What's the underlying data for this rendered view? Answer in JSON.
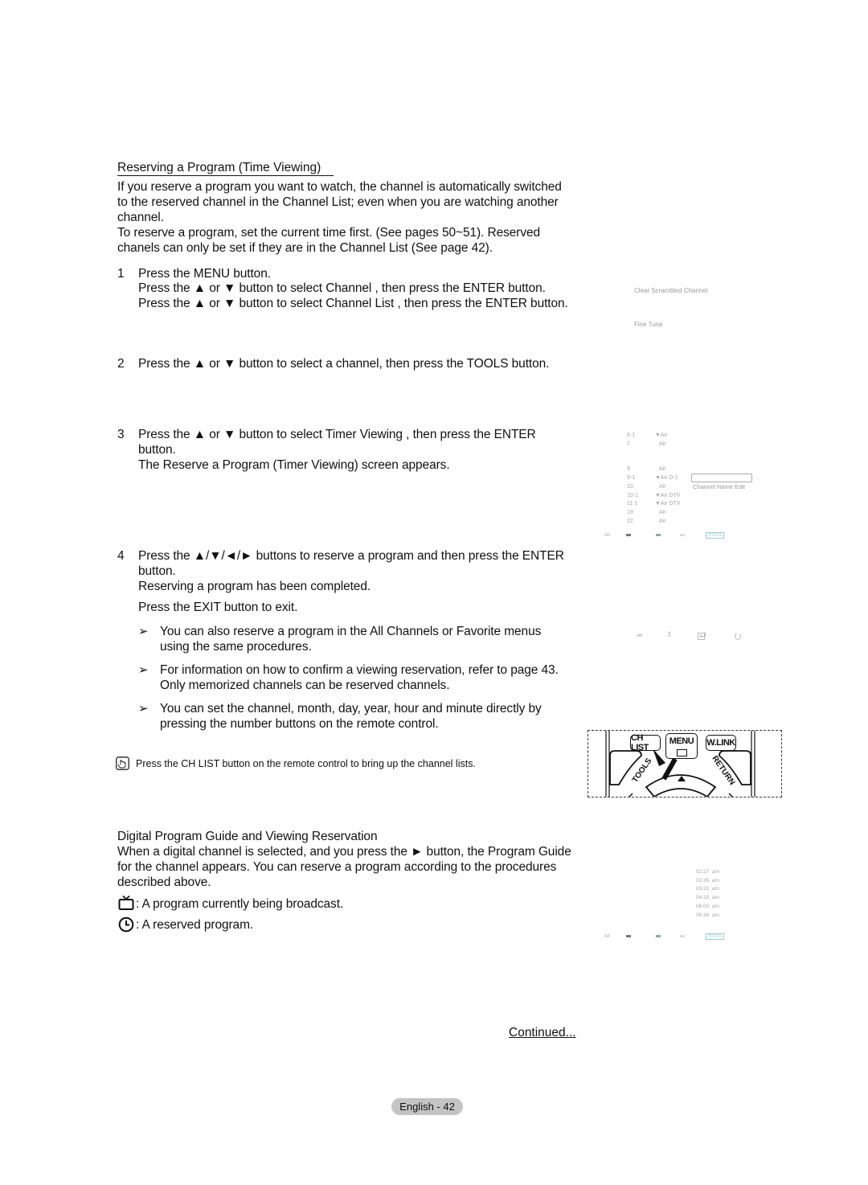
{
  "section1": {
    "title": "Reserving a Program (Time Viewing)",
    "intro": [
      "If you reserve a program you want to watch, the channel is automatically switched",
      "to the reserved channel in the Channel List; even when you are watching another",
      "channel.",
      "To reserve a program, set the current time first. (See pages 50~51). Reserved",
      "chanels can only be set if they are in the Channel List (See page 42)."
    ],
    "steps": [
      {
        "num": "1",
        "lines": [
          "Press the MENU button.",
          "Press the ▲ or ▼ button to select Channel , then press the ENTER button.",
          "Press the ▲ or ▼ button to select Channel List  , then press the ENTER button."
        ]
      },
      {
        "num": "2",
        "lines": [
          "Press the ▲ or ▼ button to select a channel, then press the TOOLS button."
        ]
      },
      {
        "num": "3",
        "lines": [
          "Press the ▲ or ▼ button to select Timer Viewing  , then press the ENTER",
          "button.",
          "The Reserve a Program (Timer Viewing) screen appears."
        ]
      },
      {
        "num": "4",
        "lines": [
          "Press the ▲/▼/◄/► buttons to reserve a program and then press the ENTER",
          "button.",
          "Reserving a program has been completed.",
          "Press the EXIT button to exit."
        ]
      }
    ],
    "notes": [
      {
        "arrow": "➢",
        "lines": [
          "You can also reserve a program in the All Channels   or Favorite  menus",
          "using the same procedures."
        ]
      },
      {
        "arrow": "➢",
        "lines": [
          "For information on how to confirm a viewing reservation, refer to page 43.",
          "Only memorized channels can be reserved channels."
        ]
      },
      {
        "arrow": "➢",
        "lines": [
          "You can set the channel, month, day, year, hour and minute directly by",
          "pressing the number buttons on the remote control."
        ]
      }
    ],
    "tip": "Press the CH LIST button on the remote control to bring up the channel lists."
  },
  "menu_screen": {
    "items": [
      "Clear Scrambled Channel",
      "Fine Tune"
    ]
  },
  "channel_list_screen": {
    "rows": [
      {
        "ch": "6-1",
        "type": "▼Air"
      },
      {
        "ch": "7",
        "type": "Air"
      },
      {
        "ch": "9",
        "type": "Air"
      },
      {
        "ch": "9-1",
        "type": "▼Air D-1"
      },
      {
        "ch": "10",
        "type": "Air"
      },
      {
        "ch": "10-1",
        "type": "▼Air DTV"
      },
      {
        "ch": "11-1",
        "type": "▼Air DTV"
      },
      {
        "ch": "19",
        "type": "Air"
      },
      {
        "ch": "22",
        "type": "Air"
      }
    ],
    "popup_label": "Channel Name Edit",
    "footer_label": "Air",
    "footer_badge": "TOOLS"
  },
  "nav_icons": [
    "move-icon",
    "adjust-icon",
    "enter-icon",
    "return-icon"
  ],
  "remote": {
    "buttons": [
      "CH LIST",
      "MENU",
      "W.LINK",
      "TOOLS",
      "RETURN"
    ]
  },
  "section2": {
    "title": "Digital Program Guide and Viewing Reservation",
    "body": [
      "When a digital channel is selected, and you press the ► button, the Program Guide",
      "for the channel appears. You can reserve a program according to the procedures",
      "described above."
    ],
    "legend": [
      {
        "icon": "tv-icon",
        "text": ": A program currently being broadcast."
      },
      {
        "icon": "clock-icon",
        "text": ": A reserved program."
      }
    ]
  },
  "guide_screen": {
    "times": [
      "02:27  am",
      "02:35  am",
      "03:21  am",
      "04:33  am",
      "06:00  am",
      "06:36  am"
    ],
    "footer_label": "Air",
    "footer_badge": "TOOLS"
  },
  "footer": {
    "continued": "Continued...",
    "page_label": "English - 42"
  }
}
